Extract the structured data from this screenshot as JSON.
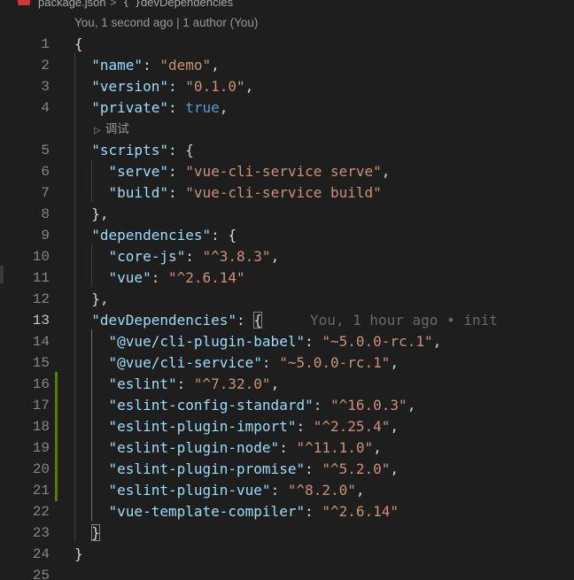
{
  "breadcrumb": {
    "file": "package.json",
    "separator": ">",
    "braces_icon": "{ }",
    "symbol": "devDependencies"
  },
  "codelens": {
    "top": "You, 1 second ago | 1 author (You)",
    "debug_icon": "play-icon",
    "debug": "调试"
  },
  "colors": {
    "background": "#1e1e1e",
    "key": "#9cdcfe",
    "string": "#ce9178",
    "boolean": "#569cd6",
    "git_modified": "#587c0c"
  },
  "active_line": 13,
  "lines": [
    {
      "n": "1",
      "tokens": [
        {
          "t": "{",
          "c": "punct"
        }
      ]
    },
    {
      "n": "2",
      "tokens": [
        {
          "t": "  ",
          "c": "punct"
        },
        {
          "t": "\"name\"",
          "c": "key"
        },
        {
          "t": ": ",
          "c": "punct"
        },
        {
          "t": "\"demo\"",
          "c": "str"
        },
        {
          "t": ",",
          "c": "punct"
        }
      ]
    },
    {
      "n": "3",
      "tokens": [
        {
          "t": "  ",
          "c": "punct"
        },
        {
          "t": "\"version\"",
          "c": "key"
        },
        {
          "t": ": ",
          "c": "punct"
        },
        {
          "t": "\"0.1.0\"",
          "c": "str"
        },
        {
          "t": ",",
          "c": "punct"
        }
      ]
    },
    {
      "n": "4",
      "tokens": [
        {
          "t": "  ",
          "c": "punct"
        },
        {
          "t": "\"private\"",
          "c": "key"
        },
        {
          "t": ": ",
          "c": "punct"
        },
        {
          "t": "true",
          "c": "bool"
        },
        {
          "t": ",",
          "c": "punct"
        }
      ]
    },
    {
      "n": "5",
      "tokens": [
        {
          "t": "  ",
          "c": "punct"
        },
        {
          "t": "\"scripts\"",
          "c": "key"
        },
        {
          "t": ": {",
          "c": "punct"
        }
      ]
    },
    {
      "n": "6",
      "tokens": [
        {
          "t": "    ",
          "c": "punct"
        },
        {
          "t": "\"serve\"",
          "c": "key"
        },
        {
          "t": ": ",
          "c": "punct"
        },
        {
          "t": "\"vue-cli-service serve\"",
          "c": "str"
        },
        {
          "t": ",",
          "c": "punct"
        }
      ]
    },
    {
      "n": "7",
      "tokens": [
        {
          "t": "    ",
          "c": "punct"
        },
        {
          "t": "\"build\"",
          "c": "key"
        },
        {
          "t": ": ",
          "c": "punct"
        },
        {
          "t": "\"vue-cli-service build\"",
          "c": "str"
        }
      ]
    },
    {
      "n": "8",
      "tokens": [
        {
          "t": "  },",
          "c": "punct"
        }
      ]
    },
    {
      "n": "9",
      "tokens": [
        {
          "t": "  ",
          "c": "punct"
        },
        {
          "t": "\"dependencies\"",
          "c": "key"
        },
        {
          "t": ": {",
          "c": "punct"
        }
      ]
    },
    {
      "n": "10",
      "tokens": [
        {
          "t": "    ",
          "c": "punct"
        },
        {
          "t": "\"core-js\"",
          "c": "key"
        },
        {
          "t": ": ",
          "c": "punct"
        },
        {
          "t": "\"^3.8.3\"",
          "c": "str"
        },
        {
          "t": ",",
          "c": "punct"
        }
      ]
    },
    {
      "n": "11",
      "tokens": [
        {
          "t": "    ",
          "c": "punct"
        },
        {
          "t": "\"vue\"",
          "c": "key"
        },
        {
          "t": ": ",
          "c": "punct"
        },
        {
          "t": "\"^2.6.14\"",
          "c": "str"
        }
      ]
    },
    {
      "n": "12",
      "tokens": [
        {
          "t": "  },",
          "c": "punct"
        }
      ]
    },
    {
      "n": "13",
      "tokens": [
        {
          "t": "  ",
          "c": "punct"
        },
        {
          "t": "\"devDependencies\"",
          "c": "key"
        },
        {
          "t": ": ",
          "c": "punct"
        },
        {
          "t": "{",
          "c": "bracket"
        },
        {
          "t": "You, 1 hour ago • init",
          "c": "blame"
        }
      ]
    },
    {
      "n": "14",
      "tokens": [
        {
          "t": "    ",
          "c": "punct"
        },
        {
          "t": "\"@vue/cli-plugin-babel\"",
          "c": "key"
        },
        {
          "t": ": ",
          "c": "punct"
        },
        {
          "t": "\"~5.0.0-rc.1\"",
          "c": "str"
        },
        {
          "t": ",",
          "c": "punct"
        }
      ]
    },
    {
      "n": "15",
      "tokens": [
        {
          "t": "    ",
          "c": "punct"
        },
        {
          "t": "\"@vue/cli-service\"",
          "c": "key"
        },
        {
          "t": ": ",
          "c": "punct"
        },
        {
          "t": "\"~5.0.0-rc.1\"",
          "c": "str"
        },
        {
          "t": ",",
          "c": "punct"
        }
      ]
    },
    {
      "n": "16",
      "tokens": [
        {
          "t": "    ",
          "c": "punct"
        },
        {
          "t": "\"eslint\"",
          "c": "key"
        },
        {
          "t": ": ",
          "c": "punct"
        },
        {
          "t": "\"^7.32.0\"",
          "c": "str"
        },
        {
          "t": ",",
          "c": "punct"
        }
      ]
    },
    {
      "n": "17",
      "tokens": [
        {
          "t": "    ",
          "c": "punct"
        },
        {
          "t": "\"eslint-config-standard\"",
          "c": "key"
        },
        {
          "t": ": ",
          "c": "punct"
        },
        {
          "t": "\"^16.0.3\"",
          "c": "str"
        },
        {
          "t": ",",
          "c": "punct"
        }
      ]
    },
    {
      "n": "18",
      "tokens": [
        {
          "t": "    ",
          "c": "punct"
        },
        {
          "t": "\"eslint-plugin-import\"",
          "c": "key"
        },
        {
          "t": ": ",
          "c": "punct"
        },
        {
          "t": "\"^2.25.4\"",
          "c": "str"
        },
        {
          "t": ",",
          "c": "punct"
        }
      ]
    },
    {
      "n": "19",
      "tokens": [
        {
          "t": "    ",
          "c": "punct"
        },
        {
          "t": "\"eslint-plugin-node\"",
          "c": "key"
        },
        {
          "t": ": ",
          "c": "punct"
        },
        {
          "t": "\"^11.1.0\"",
          "c": "str"
        },
        {
          "t": ",",
          "c": "punct"
        }
      ]
    },
    {
      "n": "20",
      "tokens": [
        {
          "t": "    ",
          "c": "punct"
        },
        {
          "t": "\"eslint-plugin-promise\"",
          "c": "key"
        },
        {
          "t": ": ",
          "c": "punct"
        },
        {
          "t": "\"^5.2.0\"",
          "c": "str"
        },
        {
          "t": ",",
          "c": "punct"
        }
      ]
    },
    {
      "n": "21",
      "tokens": [
        {
          "t": "    ",
          "c": "punct"
        },
        {
          "t": "\"eslint-plugin-vue\"",
          "c": "key"
        },
        {
          "t": ": ",
          "c": "punct"
        },
        {
          "t": "\"^8.2.0\"",
          "c": "str"
        },
        {
          "t": ",",
          "c": "punct"
        }
      ]
    },
    {
      "n": "22",
      "tokens": [
        {
          "t": "    ",
          "c": "punct"
        },
        {
          "t": "\"vue-template-compiler\"",
          "c": "key"
        },
        {
          "t": ": ",
          "c": "punct"
        },
        {
          "t": "\"^2.6.14\"",
          "c": "str"
        }
      ]
    },
    {
      "n": "23",
      "tokens": [
        {
          "t": "  ",
          "c": "punct"
        },
        {
          "t": "}",
          "c": "bracket"
        }
      ]
    },
    {
      "n": "24",
      "tokens": [
        {
          "t": "}",
          "c": "punct"
        }
      ]
    },
    {
      "n": "25",
      "tokens": []
    }
  ]
}
